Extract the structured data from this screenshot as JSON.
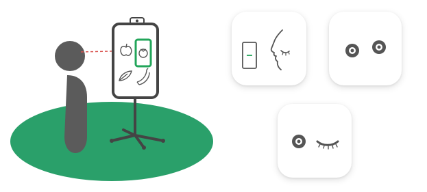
{
  "illustration": {
    "subject": "person",
    "stand": "eye-tracking-display-stand",
    "screen_items": [
      "apple-icon",
      "tomato-icon",
      "leaf-icon",
      "bananas-icon"
    ],
    "selected_item": "tomato-icon"
  },
  "tiles": [
    {
      "icon": "face-profile-with-screen-icon"
    },
    {
      "icon": "both-eyes-open-icon"
    },
    {
      "icon": "one-eye-winking-icon"
    }
  ],
  "colors": {
    "floor": "#2aa06a",
    "figure": "#5b5b5b",
    "selection": "#22a55a",
    "gaze_line": "#d9534f",
    "line_art": "#555555"
  }
}
